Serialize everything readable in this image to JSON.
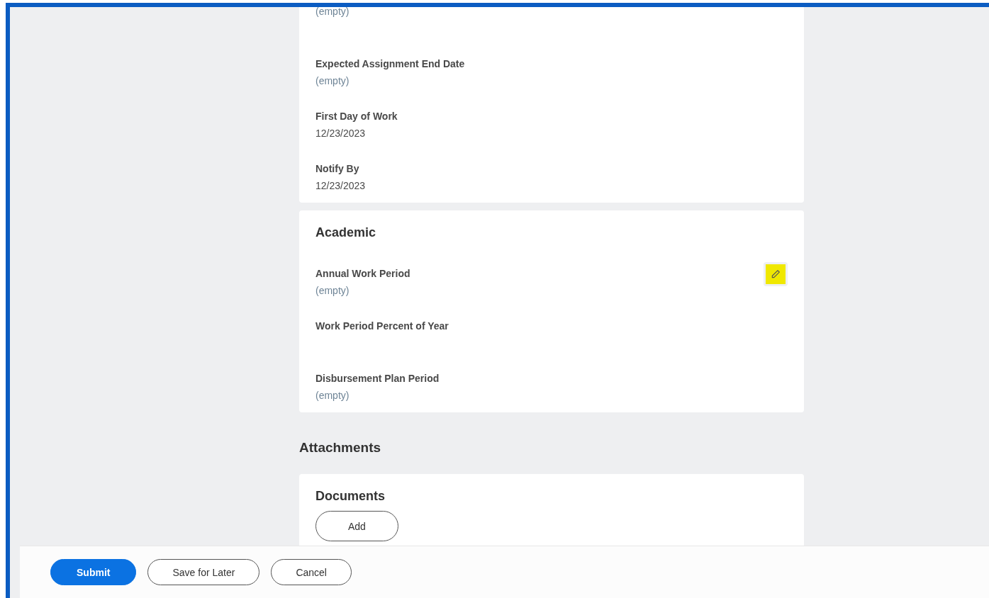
{
  "sections": [
    {
      "fields": [
        {
          "value": "(empty)",
          "empty": true
        },
        {
          "label": "Expected Assignment End Date",
          "value": "(empty)",
          "empty": true
        },
        {
          "label": "First Day of Work",
          "value": "12/23/2023",
          "empty": false
        },
        {
          "label": "Notify By",
          "value": "12/23/2023",
          "empty": false
        }
      ]
    },
    {
      "title": "Academic",
      "edit_button": {
        "highlighted": true
      },
      "fields": [
        {
          "label": "Annual Work Period",
          "value": "(empty)",
          "empty": true
        },
        {
          "label": "Work Period Percent of Year"
        },
        {
          "label": "Disbursement Plan Period",
          "value": "(empty)",
          "empty": true
        }
      ]
    }
  ],
  "attachments": {
    "heading": "Attachments",
    "documents": {
      "title": "Documents",
      "add_button": "Add"
    }
  },
  "footer": {
    "buttons": [
      {
        "label": "Submit",
        "kind": "primary"
      },
      {
        "label": "Save for Later",
        "kind": "secondary"
      },
      {
        "label": "Cancel",
        "kind": "secondary"
      }
    ]
  }
}
